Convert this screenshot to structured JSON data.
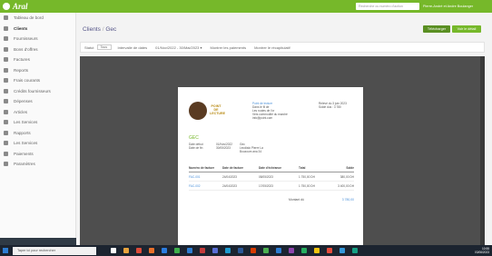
{
  "app": {
    "logo_text": "Aral",
    "search_placeholder": "Recherche ou numéro d'action",
    "user_label": "Pierre-André et Andre Boulanger"
  },
  "sidebar": {
    "items": [
      {
        "label": "Tableau de bord",
        "icon": "home-icon"
      },
      {
        "label": "Clients",
        "icon": "users-icon"
      },
      {
        "label": "Fournisseurs",
        "icon": "truck-icon"
      },
      {
        "label": "Bons d'offres",
        "icon": "document-icon"
      },
      {
        "label": "Factures",
        "icon": "invoice-icon"
      },
      {
        "label": "Reports",
        "icon": "report-icon"
      },
      {
        "label": "Frais courants",
        "icon": "expense-icon"
      },
      {
        "label": "Crédits fournisseurs",
        "icon": "credit-icon"
      },
      {
        "label": "Dépenses",
        "icon": "wallet-icon"
      },
      {
        "label": "Articles",
        "icon": "tag-icon"
      },
      {
        "label": "Les Services",
        "icon": "service-icon"
      },
      {
        "label": "Rapports",
        "icon": "chart-icon"
      },
      {
        "label": "Les Services",
        "icon": "list-icon"
      },
      {
        "label": "Paiements",
        "icon": "payment-icon"
      },
      {
        "label": "Paramètres",
        "icon": "settings-icon"
      }
    ]
  },
  "header": {
    "breadcrumb_parent": "Clients",
    "breadcrumb_sep": "/",
    "breadcrumb_current": "Gec",
    "download_label": "Télécharger",
    "view_label": "Voir le détail"
  },
  "filters": {
    "status_label": "Statut",
    "status_value": "Tous",
    "period_label": "Intervalle de dates",
    "date_range": "01/Nov/2022 - 30/Mai/2023 ▾",
    "check1": "Montrer les paiements",
    "check2": "Montrer le récapitulatif"
  },
  "document": {
    "logo_text": "POINT DE LECTURE",
    "company_name": "Point de lecture",
    "company_lines": [
      "Dans le fil de",
      "Les routes de l'or",
      "Vers commodité du marché",
      "info@point.com"
    ],
    "meta_lines": [
      "Relevé du 3 juin 2023",
      "Solde dus : 3 780"
    ],
    "client_name": "GEC",
    "info_rows": [
      [
        "Date début",
        "01/Nov/2022",
        "Gec"
      ],
      [
        "Date de fin",
        "30/05/2023",
        "Leodialo Pierre La"
      ],
      [
        "",
        "",
        "Bouzoum ana 34"
      ]
    ],
    "table": {
      "headers": [
        "Numéro de facture",
        "Date de facture",
        "Date d'échéance",
        "Total",
        "Solde"
      ],
      "rows": [
        [
          "FAC-001",
          "24/04/2023",
          "08/05/2023",
          "1 750,00 DH",
          "380,00 DH"
        ],
        [
          "FAC-002",
          "24/04/2023",
          "17/05/2023",
          "1 750,00 DH",
          "3 400,00 DH"
        ]
      ]
    },
    "total_label": "Montant dû",
    "total_value": "3 780,00"
  },
  "taskbar": {
    "search_placeholder": "Taper ici pour rechercher",
    "time": "10:55",
    "date": "03/06/2023"
  }
}
